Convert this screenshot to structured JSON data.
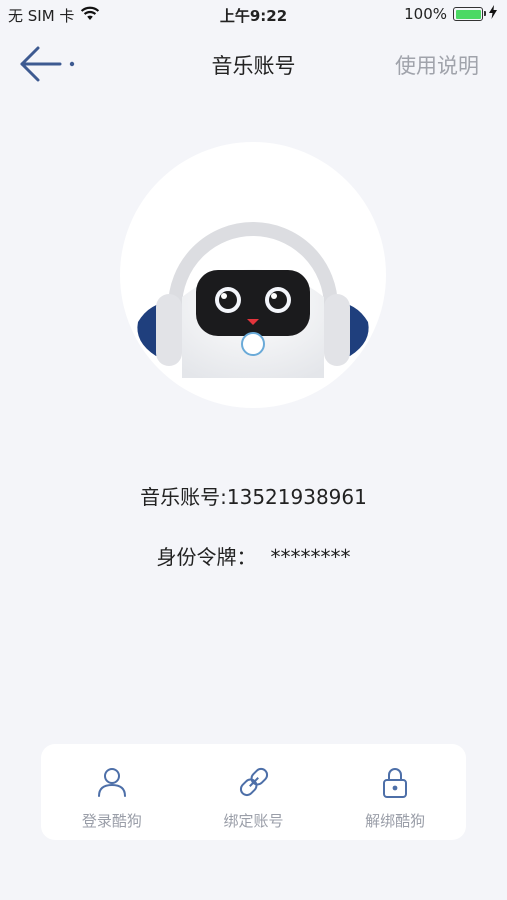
{
  "status_bar": {
    "carrier": "无 SIM 卡",
    "time": "上午9:22",
    "battery": "100%",
    "battery_level": 1.0
  },
  "nav": {
    "title": "音乐账号",
    "help_label": "使用说明"
  },
  "account": {
    "label": "音乐账号",
    "value": "13521938961",
    "text": "音乐账号:13521938961"
  },
  "token": {
    "label": "身份令牌：",
    "value": "********"
  },
  "actions": [
    {
      "label": "登录酷狗",
      "icon": "user-icon"
    },
    {
      "label": "绑定账号",
      "icon": "link-icon"
    },
    {
      "label": "解绑酷狗",
      "icon": "lock-icon"
    }
  ],
  "colors": {
    "background": "#f4f5f9",
    "nav_icon": "#3d5a91",
    "action_icon": "#4d6fa8",
    "muted_text": "#9a9ea8",
    "battery": "#4cd964"
  }
}
